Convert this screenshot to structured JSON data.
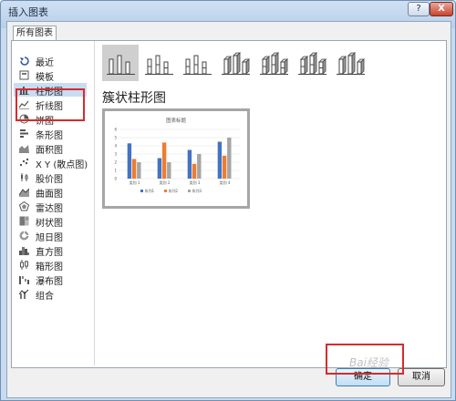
{
  "window": {
    "title": "插入图表",
    "help_label": "?",
    "close_label": "X"
  },
  "tab": {
    "label": "所有图表"
  },
  "sidebar": {
    "items": [
      {
        "label": "最近",
        "icon": "recent-icon"
      },
      {
        "label": "模板",
        "icon": "template-icon"
      },
      {
        "label": "柱形图",
        "icon": "column-chart-icon",
        "selected": true
      },
      {
        "label": "折线图",
        "icon": "line-chart-icon"
      },
      {
        "label": "饼图",
        "icon": "pie-chart-icon"
      },
      {
        "label": "条形图",
        "icon": "bar-chart-icon"
      },
      {
        "label": "面积图",
        "icon": "area-chart-icon"
      },
      {
        "label": "X Y (散点图)",
        "icon": "scatter-chart-icon"
      },
      {
        "label": "股价图",
        "icon": "stock-chart-icon"
      },
      {
        "label": "曲面图",
        "icon": "surface-chart-icon"
      },
      {
        "label": "雷达图",
        "icon": "radar-chart-icon"
      },
      {
        "label": "树状图",
        "icon": "treemap-chart-icon"
      },
      {
        "label": "旭日图",
        "icon": "sunburst-chart-icon"
      },
      {
        "label": "直方图",
        "icon": "histogram-chart-icon"
      },
      {
        "label": "箱形图",
        "icon": "box-whisker-chart-icon"
      },
      {
        "label": "瀑布图",
        "icon": "waterfall-chart-icon"
      },
      {
        "label": "组合",
        "icon": "combo-chart-icon"
      }
    ]
  },
  "subtypes": [
    {
      "name": "clustered-column-icon",
      "selected": true
    },
    {
      "name": "stacked-column-icon"
    },
    {
      "name": "100-stacked-column-icon"
    },
    {
      "name": "3d-clustered-column-icon"
    },
    {
      "name": "3d-stacked-column-icon"
    },
    {
      "name": "3d-100-stacked-column-icon"
    },
    {
      "name": "3d-column-icon"
    }
  ],
  "heading": "簇状柱形图",
  "chart_data": {
    "type": "bar",
    "title": "图表标题",
    "categories": [
      "类别 1",
      "类别 2",
      "类别 3",
      "类别 4"
    ],
    "series": [
      {
        "name": "系列1",
        "color": "#4472c4",
        "values": [
          4.3,
          2.5,
          3.5,
          4.5
        ]
      },
      {
        "name": "系列2",
        "color": "#ed7d31",
        "values": [
          2.4,
          4.4,
          1.8,
          2.8
        ]
      },
      {
        "name": "系列3",
        "color": "#a5a5a5",
        "values": [
          2,
          2,
          3,
          5
        ]
      }
    ],
    "ylim": [
      0,
      6
    ],
    "yticks": [
      "0",
      "1",
      "2",
      "3",
      "4",
      "5",
      "6"
    ],
    "grid": true,
    "legend": "bottom"
  },
  "footer": {
    "ok_label": "确定",
    "cancel_label": "取消",
    "watermark": "Bai经验"
  }
}
